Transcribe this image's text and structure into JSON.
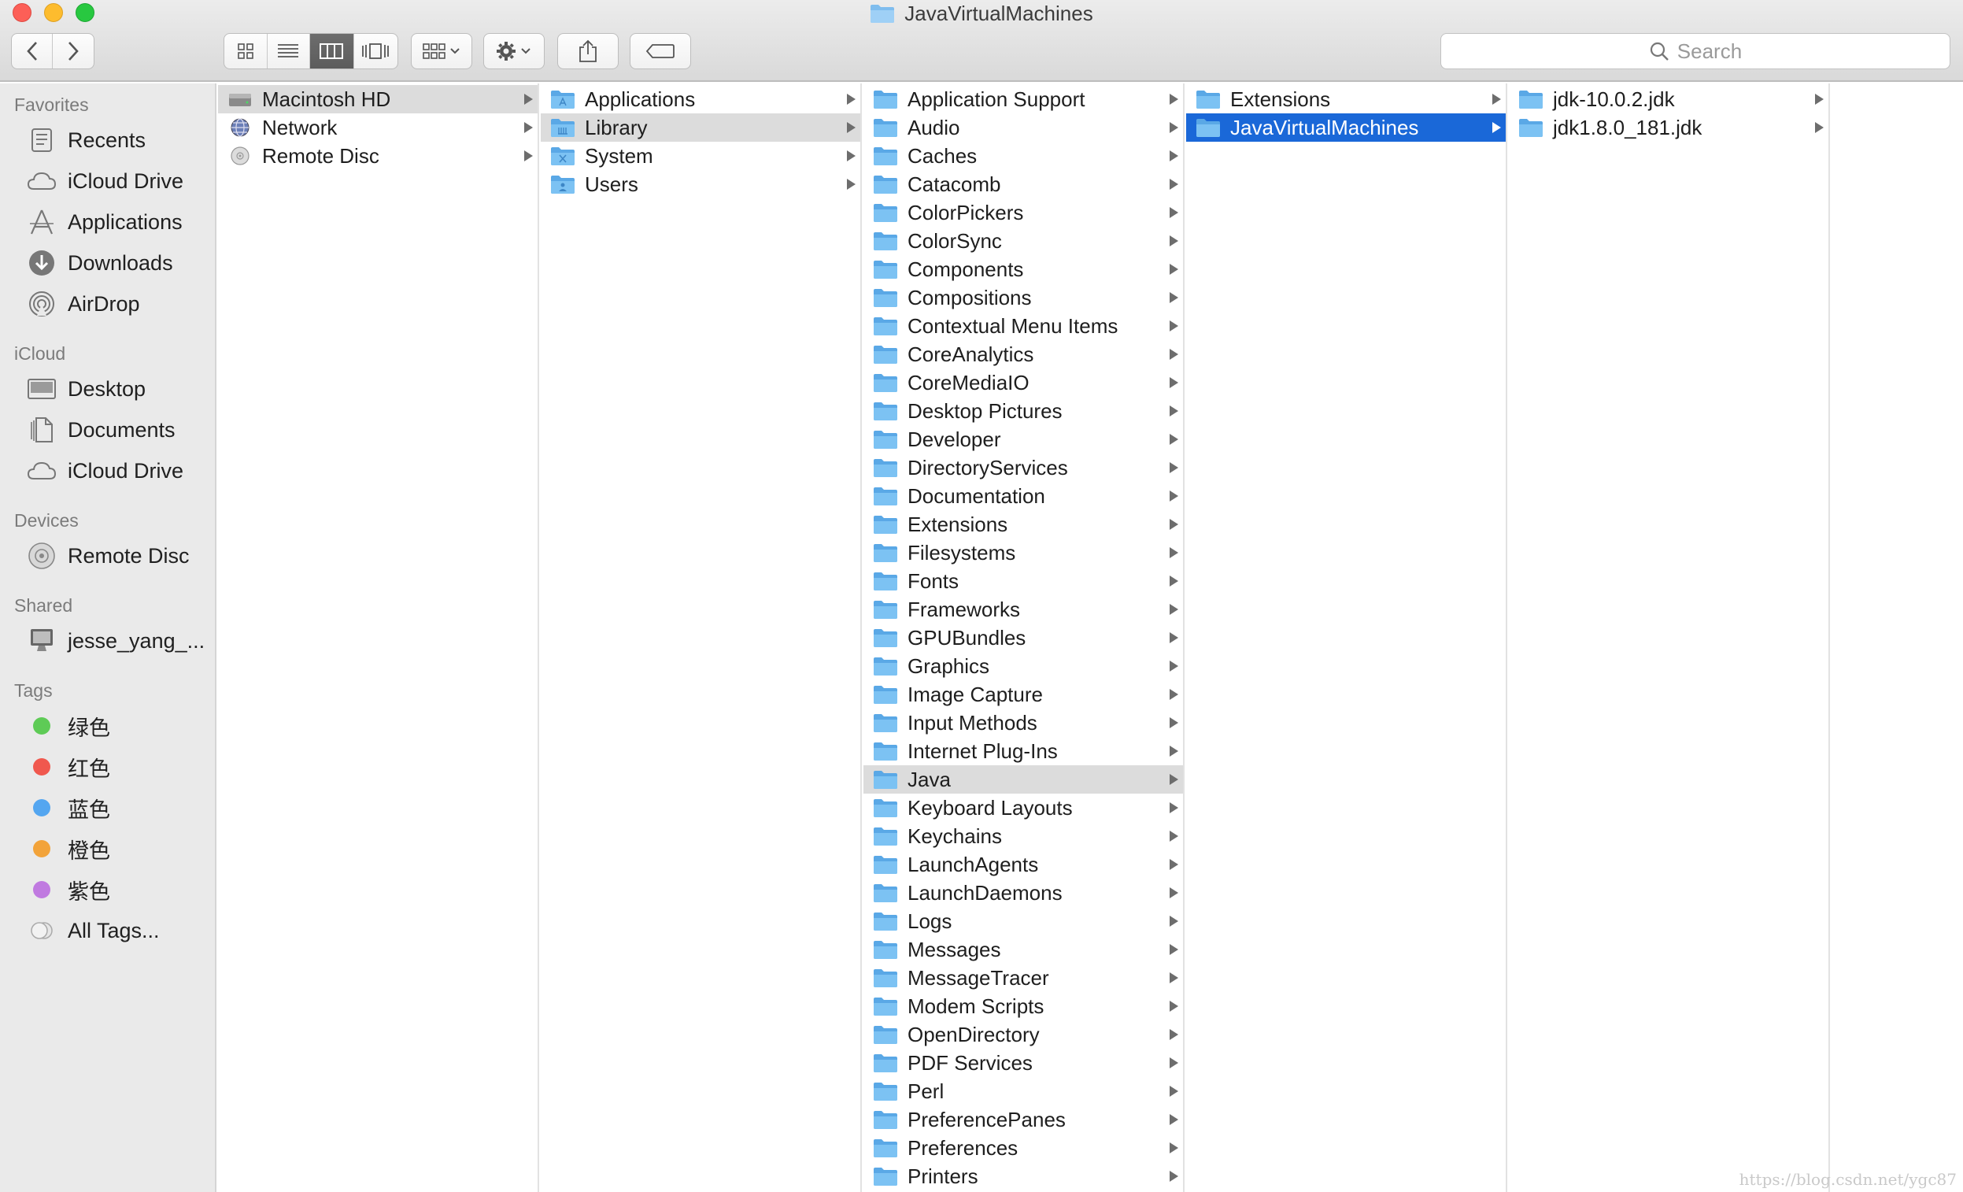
{
  "window": {
    "title": "JavaVirtualMachines"
  },
  "colors": {
    "selection_blue": "#1a68d8",
    "folder_blue": "#6cb6ee",
    "tag_green": "#5ecb56",
    "tag_red": "#f0584e",
    "tag_blue": "#54a6f0",
    "tag_orange": "#f2a33a",
    "tag_purple": "#c07ae0"
  },
  "toolbar": {
    "back": "back-icon",
    "forward": "forward-icon",
    "views": [
      "icon-view-icon",
      "list-view-icon",
      "column-view-icon",
      "cover-flow-icon"
    ],
    "active_view": "column",
    "search_placeholder": "Search"
  },
  "sidebar": {
    "sections": [
      {
        "title": "Favorites",
        "items": [
          {
            "label": "Recents",
            "icon": "recents-icon"
          },
          {
            "label": "iCloud Drive",
            "icon": "cloud-icon"
          },
          {
            "label": "Applications",
            "icon": "applications-icon"
          },
          {
            "label": "Downloads",
            "icon": "downloads-icon"
          },
          {
            "label": "AirDrop",
            "icon": "airdrop-icon"
          }
        ]
      },
      {
        "title": "iCloud",
        "items": [
          {
            "label": "Desktop",
            "icon": "desktop-icon"
          },
          {
            "label": "Documents",
            "icon": "documents-icon"
          },
          {
            "label": "iCloud Drive",
            "icon": "cloud-icon"
          }
        ]
      },
      {
        "title": "Devices",
        "items": [
          {
            "label": "Remote Disc",
            "icon": "remote-disc-icon"
          }
        ]
      },
      {
        "title": "Shared",
        "items": [
          {
            "label": "jesse_yang_...",
            "icon": "computer-icon"
          }
        ]
      },
      {
        "title": "Tags",
        "items": [
          {
            "label": "绿色",
            "color": "#5ecb56"
          },
          {
            "label": "红色",
            "color": "#f0584e"
          },
          {
            "label": "蓝色",
            "color": "#54a6f0"
          },
          {
            "label": "橙色",
            "color": "#f2a33a"
          },
          {
            "label": "紫色",
            "color": "#c07ae0"
          },
          {
            "label": "All Tags...",
            "icon": "all-tags-icon"
          }
        ]
      }
    ]
  },
  "columns": [
    {
      "items": [
        {
          "label": "Macintosh HD",
          "icon": "hard-drive-icon",
          "selected": "gray"
        },
        {
          "label": "Network",
          "icon": "network-icon"
        },
        {
          "label": "Remote Disc",
          "icon": "remote-disc-icon"
        }
      ]
    },
    {
      "items": [
        {
          "label": "Applications",
          "icon": "applications-folder-icon"
        },
        {
          "label": "Library",
          "icon": "library-folder-icon",
          "selected": "gray"
        },
        {
          "label": "System",
          "icon": "system-folder-icon"
        },
        {
          "label": "Users",
          "icon": "users-folder-icon"
        }
      ]
    },
    {
      "items": [
        {
          "label": "Application Support"
        },
        {
          "label": "Audio"
        },
        {
          "label": "Caches"
        },
        {
          "label": "Catacomb"
        },
        {
          "label": "ColorPickers"
        },
        {
          "label": "ColorSync"
        },
        {
          "label": "Components"
        },
        {
          "label": "Compositions"
        },
        {
          "label": "Contextual Menu Items"
        },
        {
          "label": "CoreAnalytics"
        },
        {
          "label": "CoreMediaIO"
        },
        {
          "label": "Desktop Pictures"
        },
        {
          "label": "Developer"
        },
        {
          "label": "DirectoryServices"
        },
        {
          "label": "Documentation"
        },
        {
          "label": "Extensions"
        },
        {
          "label": "Filesystems"
        },
        {
          "label": "Fonts"
        },
        {
          "label": "Frameworks"
        },
        {
          "label": "GPUBundles"
        },
        {
          "label": "Graphics"
        },
        {
          "label": "Image Capture"
        },
        {
          "label": "Input Methods"
        },
        {
          "label": "Internet Plug-Ins"
        },
        {
          "label": "Java",
          "selected": "gray"
        },
        {
          "label": "Keyboard Layouts"
        },
        {
          "label": "Keychains"
        },
        {
          "label": "LaunchAgents"
        },
        {
          "label": "LaunchDaemons"
        },
        {
          "label": "Logs"
        },
        {
          "label": "Messages"
        },
        {
          "label": "MessageTracer"
        },
        {
          "label": "Modem Scripts"
        },
        {
          "label": "OpenDirectory"
        },
        {
          "label": "PDF Services"
        },
        {
          "label": "Perl"
        },
        {
          "label": "PreferencePanes"
        },
        {
          "label": "Preferences"
        },
        {
          "label": "Printers"
        }
      ]
    },
    {
      "items": [
        {
          "label": "Extensions"
        },
        {
          "label": "JavaVirtualMachines",
          "selected": "blue"
        }
      ]
    },
    {
      "items": [
        {
          "label": "jdk-10.0.2.jdk"
        },
        {
          "label": "jdk1.8.0_181.jdk"
        }
      ]
    }
  ],
  "watermark": "https://blog.csdn.net/ygc87"
}
